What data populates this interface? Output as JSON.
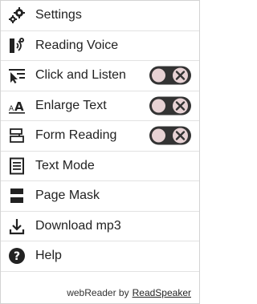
{
  "menu": {
    "items": [
      {
        "label": "Settings",
        "icon": "gear-icon"
      },
      {
        "label": "Reading Voice",
        "icon": "voice-icon"
      },
      {
        "label": "Click and Listen",
        "icon": "cursor-text-icon",
        "toggle": "off"
      },
      {
        "label": "Enlarge Text",
        "icon": "enlarge-text-icon",
        "toggle": "off"
      },
      {
        "label": "Form Reading",
        "icon": "form-icon",
        "toggle": "off"
      },
      {
        "label": "Text Mode",
        "icon": "text-mode-icon"
      },
      {
        "label": "Page Mask",
        "icon": "page-mask-icon"
      },
      {
        "label": "Download mp3",
        "icon": "download-icon"
      },
      {
        "label": "Help",
        "icon": "help-icon"
      }
    ]
  },
  "footer": {
    "prefix": "webReader by",
    "brand": "ReadSpeaker"
  },
  "colors": {
    "toggle_track": "#333333",
    "toggle_knob": "#e7d2d4",
    "text": "#222222",
    "divider": "#e2e2e2"
  }
}
